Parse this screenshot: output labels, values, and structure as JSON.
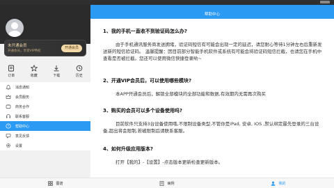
{
  "sidebar": {
    "vip_card": {
      "title": "未开通会员",
      "subtitle": "开通会员，享受VIP特权",
      "button_label": "开通会员"
    },
    "quick_actions": [
      {
        "label": "订单",
        "icon": "order-icon"
      },
      {
        "label": "收藏",
        "icon": "star-icon"
      },
      {
        "label": "下载",
        "icon": "download-icon"
      },
      {
        "label": "历史",
        "icon": "history-icon"
      }
    ],
    "menu_items": [
      {
        "label": "消息通知",
        "icon": "bell-icon"
      },
      {
        "label": "会员服务",
        "icon": "crown-icon"
      },
      {
        "label": "商务合作",
        "icon": "handshake-icon"
      },
      {
        "label": "联系客服",
        "icon": "headset-icon"
      },
      {
        "label": "帮助中心",
        "icon": "help-icon",
        "active": true
      },
      {
        "label": "意见反馈",
        "icon": "feedback-icon"
      },
      {
        "label": "设置",
        "icon": "gear-icon"
      }
    ]
  },
  "header": {
    "title": "帮助中心"
  },
  "faq": [
    {
      "question": "1、我的手机一直收不到验证码怎么办?",
      "answer": "由于手机通讯服务商发送拥堵，验证码短信有可能会出现一定的延迟，请您耐心等待1分钟左右后重新发送新的短信验证码。 温馨提醒：因目前部分智能手机软件或系统有可能会将验证码短信拦截，也请您在手机中查看是否被拦截。您还可以使用微信快捷登录哟~"
    },
    {
      "question": "2、开通VIP会员后，可以使用哪些模块?",
      "answer": "本APP开通会员后，解锁全部模块的全部功能和数据,有效期内无需再次购买"
    },
    {
      "question": "3、购买的会员可以多个设备使用吗?",
      "answer": "目前软件只支持3台设备使用哦,不限制设备类型,不管你是iPad, 安卓, IOS ,默认绑定最先登录的三台设备,超出将会限制,若被限制后请联系客服。"
    },
    {
      "question": "4、如何升级应用版本?",
      "answer": "打开【我的】-【设置】-点击版本更新检查更新版本。"
    }
  ],
  "tabbar": [
    {
      "label": "图谱",
      "icon": "grid-icon"
    },
    {
      "label": "病例",
      "icon": "document-icon"
    },
    {
      "label": "我的",
      "icon": "user-icon",
      "active": true
    }
  ],
  "colors": {
    "accent": "#2b9af3",
    "vip_gold": "#f3d9a8",
    "dark_header": "#2b2b2b"
  }
}
